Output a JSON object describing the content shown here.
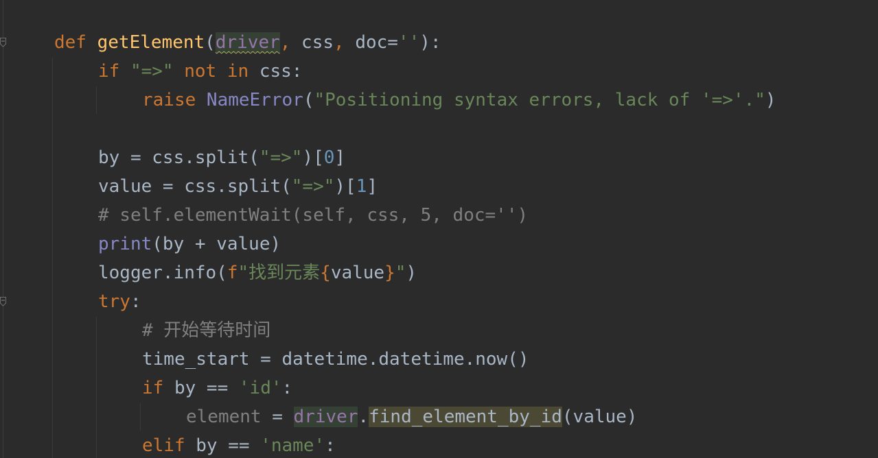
{
  "editor": {
    "colors": {
      "background": "#2b2b2b",
      "keyword": "#cc7832",
      "function": "#ffc66d",
      "string": "#6a8759",
      "number": "#6897bb",
      "comment": "#808080",
      "builtin": "#8888c6",
      "parameter": "#9876aa"
    },
    "icons": [
      "fold-marker-icon"
    ],
    "lines": [
      {
        "t": [
          {
            "c": "kw",
            "v": "def "
          },
          {
            "c": "fn",
            "v": "getElement"
          },
          {
            "c": "",
            "v": "("
          },
          {
            "c": "warn",
            "v": "driver"
          },
          {
            "c": "kw",
            "v": ","
          },
          {
            "c": "",
            "v": " css"
          },
          {
            "c": "kw",
            "v": ","
          },
          {
            "c": "",
            "v": " doc="
          },
          {
            "c": "str",
            "v": "''"
          },
          {
            "c": "",
            "v": "):"
          }
        ]
      },
      {
        "t": [
          {
            "c": "kw",
            "v": "if "
          },
          {
            "c": "str",
            "v": "\"=>\""
          },
          {
            "c": "kw",
            "v": " not in "
          },
          {
            "c": "",
            "v": "css:"
          }
        ]
      },
      {
        "t": [
          {
            "c": "kw",
            "v": "raise "
          },
          {
            "c": "bi",
            "v": "NameError"
          },
          {
            "c": "",
            "v": "("
          },
          {
            "c": "str",
            "v": "\"Positioning syntax errors, lack of '=>'.\""
          },
          {
            "c": "",
            "v": ")"
          }
        ]
      },
      {
        "t": []
      },
      {
        "t": [
          {
            "c": "",
            "v": "by = css.split("
          },
          {
            "c": "str",
            "v": "\"=>\""
          },
          {
            "c": "",
            "v": ")["
          },
          {
            "c": "num",
            "v": "0"
          },
          {
            "c": "",
            "v": "]"
          }
        ]
      },
      {
        "t": [
          {
            "c": "",
            "v": "value = css.split("
          },
          {
            "c": "str",
            "v": "\"=>\""
          },
          {
            "c": "",
            "v": ")["
          },
          {
            "c": "num",
            "v": "1"
          },
          {
            "c": "",
            "v": "]"
          }
        ]
      },
      {
        "t": [
          {
            "c": "cm",
            "v": "# self.elementWait(self, css, 5, doc='')"
          }
        ]
      },
      {
        "t": [
          {
            "c": "bi",
            "v": "print"
          },
          {
            "c": "",
            "v": "(by + value)"
          }
        ]
      },
      {
        "t": [
          {
            "c": "",
            "v": "logger.info("
          },
          {
            "c": "kw",
            "v": "f"
          },
          {
            "c": "str",
            "v": "\"找到元素"
          },
          {
            "c": "kw",
            "v": "{"
          },
          {
            "c": "",
            "v": "value"
          },
          {
            "c": "kw",
            "v": "}"
          },
          {
            "c": "str",
            "v": "\""
          },
          {
            "c": "",
            "v": ")"
          }
        ]
      },
      {
        "t": [
          {
            "c": "kw",
            "v": "try"
          },
          {
            "c": "",
            "v": ":"
          }
        ]
      },
      {
        "t": [
          {
            "c": "cm",
            "v": "# 开始等待时间"
          }
        ]
      },
      {
        "t": [
          {
            "c": "",
            "v": "time_start = datetime.datetime.now()"
          }
        ]
      },
      {
        "t": [
          {
            "c": "kw",
            "v": "if "
          },
          {
            "c": "",
            "v": "by == "
          },
          {
            "c": "str",
            "v": "'id'"
          },
          {
            "c": "",
            "v": ":"
          }
        ]
      },
      {
        "t": [
          {
            "c": "dim",
            "v": "element"
          },
          {
            "c": "",
            "v": " = "
          },
          {
            "c": "hl-var",
            "v": "driver"
          },
          {
            "c": "",
            "v": "."
          },
          {
            "c": "hl-method",
            "v": "find_element_by_id"
          },
          {
            "c": "",
            "v": "(value)"
          }
        ]
      },
      {
        "t": [
          {
            "c": "kw",
            "v": "elif "
          },
          {
            "c": "",
            "v": "by == "
          },
          {
            "c": "str",
            "v": "'name'"
          },
          {
            "c": "",
            "v": ":"
          }
        ]
      }
    ]
  }
}
